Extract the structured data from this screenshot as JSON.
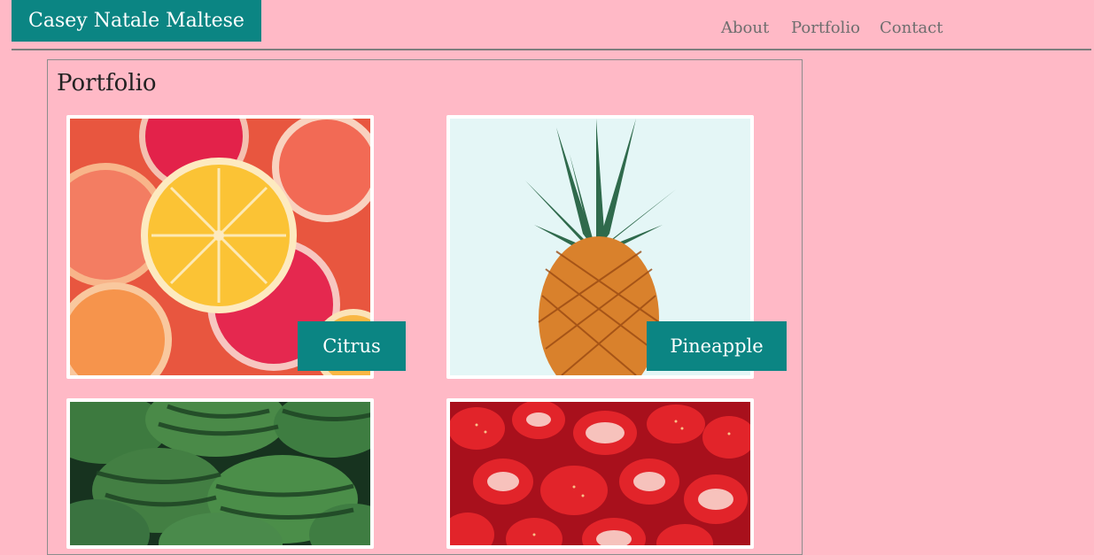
{
  "header": {
    "site_title": "Casey Natale Maltese",
    "nav": [
      "About",
      "Portfolio",
      "Contact"
    ]
  },
  "main": {
    "section_title": "Portfolio",
    "items": [
      {
        "label": "Citrus",
        "image": "citrus-slices-photo"
      },
      {
        "label": "Pineapple",
        "image": "pineapple-photo"
      },
      {
        "label": "",
        "image": "watermelons-photo"
      },
      {
        "label": "",
        "image": "strawberries-photo"
      }
    ]
  },
  "colors": {
    "background": "#ffb9c6",
    "accent": "#0b8583",
    "nav_text": "#6e6e6e"
  }
}
